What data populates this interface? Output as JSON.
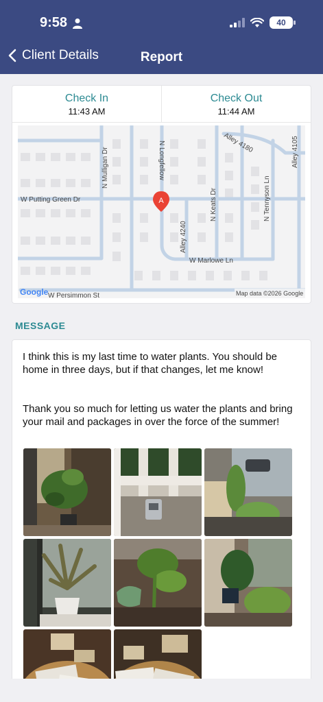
{
  "status_bar": {
    "time": "9:58",
    "battery": "40"
  },
  "nav": {
    "back_label": "Client Details",
    "title": "Report"
  },
  "check_in": {
    "label": "Check In",
    "time": "11:43 AM"
  },
  "check_out": {
    "label": "Check Out",
    "time": "11:44 AM"
  },
  "map": {
    "marker": "A",
    "streets": [
      "W Putting Green Dr",
      "N Mulligan Dr",
      "N Longfellow",
      "Alley 4180",
      "Alley 4105",
      "N Tennyson Ln",
      "N Keats Dr",
      "Alley 4240",
      "W Marlowe Ln",
      "W Persimmon St"
    ],
    "attribution": "Map data ©2026 Google",
    "logo": "Google"
  },
  "message": {
    "section_label": "MESSAGE",
    "paragraph1": "I think this is my last time to water plants.  You should be home in three days, but if that changes, let me know!",
    "paragraph2": "Thank you so much for letting us water the plants and bring your mail and packages in over the force of the summer!"
  },
  "photos_count": 8
}
